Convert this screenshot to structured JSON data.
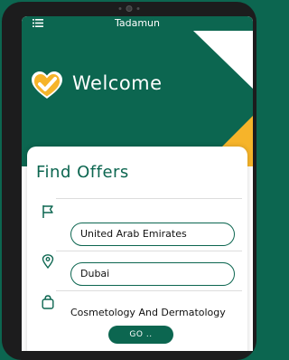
{
  "appbar": {
    "title": "Tadamun",
    "menu_icon": "hamburger-menu-icon"
  },
  "hero": {
    "welcome_text": "Welcome",
    "logo_icon": "heart-check-logo"
  },
  "find_offers": {
    "title": "Find Offers",
    "country": {
      "icon": "flag-icon",
      "value": "United Arab Emirates"
    },
    "city": {
      "icon": "location-pin-icon",
      "value": "Dubai"
    },
    "category": {
      "icon": "shopping-bag-icon",
      "value": "Cosmetology And Dermatology"
    },
    "go_label": "GO .."
  },
  "colors": {
    "primary": "#0c6650",
    "accent": "#f6b42a",
    "surface": "#ffffff"
  }
}
